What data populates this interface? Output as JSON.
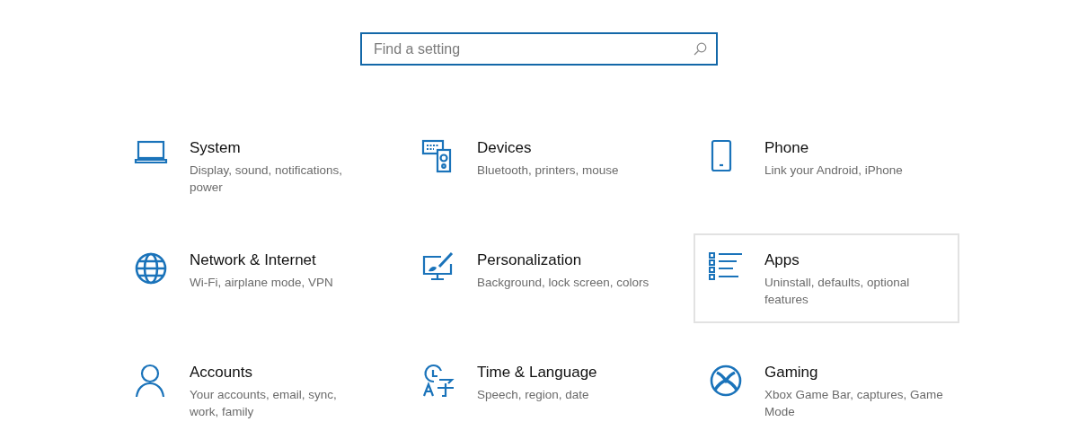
{
  "search": {
    "placeholder": "Find a setting"
  },
  "categories": [
    {
      "title": "System",
      "description": "Display, sound, notifications,\npower",
      "selected": false
    },
    {
      "title": "Devices",
      "description": "Bluetooth, printers, mouse",
      "selected": false
    },
    {
      "title": "Phone",
      "description": "Link your Android, iPhone",
      "selected": false
    },
    {
      "title": "Network & Internet",
      "description": "Wi-Fi, airplane mode, VPN",
      "selected": false
    },
    {
      "title": "Personalization",
      "description": "Background, lock screen, colors",
      "selected": false
    },
    {
      "title": "Apps",
      "description": "Uninstall, defaults, optional\nfeatures",
      "selected": true
    },
    {
      "title": "Accounts",
      "description": "Your accounts, email, sync,\nwork, family",
      "selected": false
    },
    {
      "title": "Time & Language",
      "description": "Speech, region, date",
      "selected": false
    },
    {
      "title": "Gaming",
      "description": "Xbox Game Bar, captures, Game\nMode",
      "selected": false
    }
  ]
}
